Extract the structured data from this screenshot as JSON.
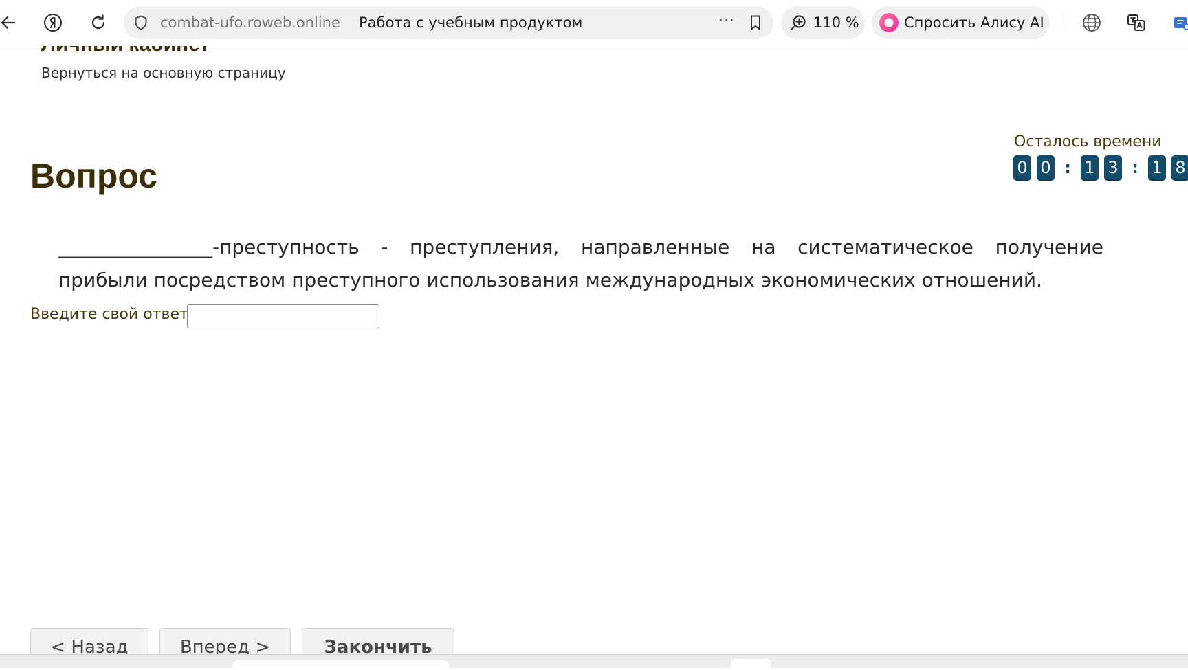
{
  "browser": {
    "url_domain": "combat-ufo.roweb.online",
    "page_title": "Работа с учебным продуктом",
    "more_label": "···",
    "zoom_level": "110 %",
    "alice_label": "Спросить Алису AI",
    "icons": {
      "back": "arrow-left-icon",
      "yandex": "yandex-logo-icon",
      "reload": "reload-icon",
      "shield": "shield-icon",
      "bookmark": "bookmark-icon",
      "zoom": "zoom-icon",
      "alice": "alice-icon",
      "globe": "globe-icon",
      "translate": "translate-icon",
      "extension": "extension-icon"
    }
  },
  "page": {
    "cabinet_title": "Личный кабинет",
    "back_link": "Вернуться на основную страницу",
    "timer": {
      "label": "Осталось времени",
      "hours": [
        "0",
        "0"
      ],
      "minutes": [
        "1",
        "3"
      ],
      "seconds": [
        "1",
        "8"
      ],
      "separator": ":"
    },
    "question_heading": "Вопрос",
    "question_text": "________________-преступность - преступления, направленные на систематическое получение прибыли посредством преступного использования международных экономических отношений.",
    "answer_label": "Введите свой ответ",
    "answer_value": "",
    "buttons": {
      "back": "< Назад",
      "next": "Вперед >",
      "finish": "Закончить"
    }
  },
  "colors": {
    "heading": "#3d2e0a",
    "timer_digit_bg": "#134d6b",
    "alice_accent": "#ee4a9a"
  }
}
